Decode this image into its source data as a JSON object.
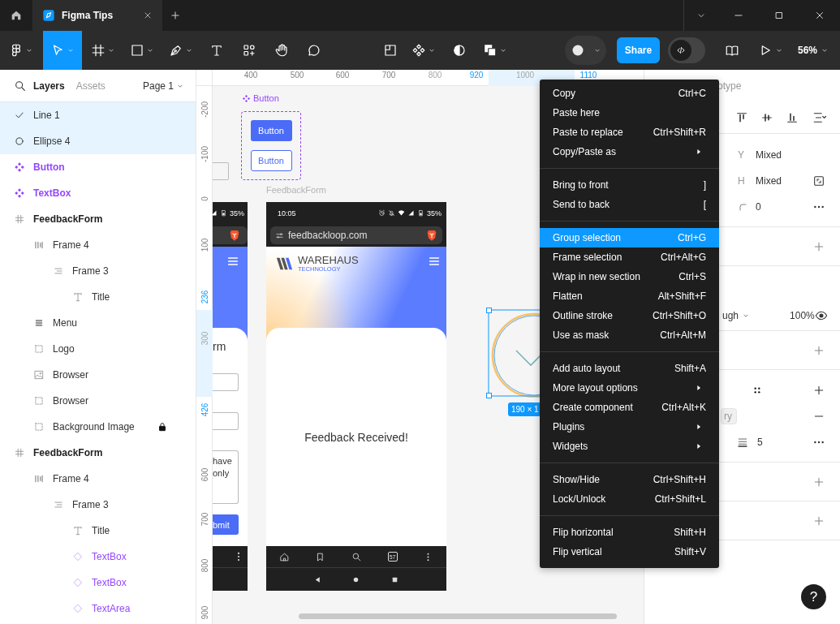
{
  "title_bar": {
    "tabs": [
      {
        "label": "Figma Tips",
        "selected": true
      }
    ]
  },
  "toolbar": {
    "tools": [
      {
        "kind": "main-menu",
        "selected": false,
        "menu": true
      },
      {
        "kind": "move",
        "selected": true,
        "menu": true
      },
      {
        "kind": "frame",
        "selected": false,
        "menu": true
      },
      {
        "kind": "rectangle",
        "selected": false,
        "menu": true
      },
      {
        "kind": "pen",
        "selected": false,
        "menu": true
      },
      {
        "kind": "text",
        "selected": false,
        "menu": false
      },
      {
        "kind": "resources",
        "selected": false,
        "menu": false
      },
      {
        "kind": "hand",
        "selected": false,
        "menu": false
      },
      {
        "kind": "comment",
        "selected": false,
        "menu": false
      }
    ],
    "actions": [
      {
        "kind": "layout",
        "menu": false
      },
      {
        "kind": "component",
        "menu": true
      },
      {
        "kind": "mask",
        "menu": false
      },
      {
        "kind": "boolean",
        "menu": true
      }
    ],
    "share": "Share",
    "dev_mode": {
      "on": false
    },
    "zoom": "56%"
  },
  "layers_panel": {
    "tabs": [
      {
        "label": "Layers",
        "selected": true
      },
      {
        "label": "Assets",
        "selected": false
      }
    ],
    "page": "Page 1",
    "layers": [
      {
        "name": "Line 1",
        "kind": "line",
        "selected": true,
        "locked": false
      },
      {
        "name": "Ellipse 4",
        "kind": "ellipse",
        "selected": true,
        "locked": false
      },
      {
        "name": "Button",
        "kind": "component-set",
        "selected": false,
        "locked": false
      },
      {
        "name": "TextBox",
        "kind": "component-set",
        "selected": false,
        "locked": false
      },
      {
        "name": "FeedbackForm",
        "kind": "frame",
        "selected": false,
        "locked": false,
        "children": [
          {
            "name": "Frame 4",
            "kind": "row",
            "selected": false,
            "locked": false,
            "children": [
              {
                "name": "Frame 3",
                "kind": "column",
                "selected": false,
                "locked": false,
                "children": [
                  {
                    "name": "Title",
                    "kind": "text",
                    "selected": false,
                    "locked": false
                  }
                ]
              }
            ]
          },
          {
            "name": "Menu",
            "kind": "stack",
            "selected": false,
            "locked": false
          },
          {
            "name": "Logo",
            "kind": "group",
            "selected": false,
            "locked": false
          },
          {
            "name": "Browser",
            "kind": "image",
            "selected": false,
            "locked": false
          },
          {
            "name": "Browser",
            "kind": "group",
            "selected": false,
            "locked": false
          },
          {
            "name": "Background Image",
            "kind": "group",
            "selected": false,
            "locked": true
          }
        ]
      },
      {
        "name": "FeedbackForm",
        "kind": "frame",
        "selected": false,
        "locked": false,
        "children": [
          {
            "name": "Frame 4",
            "kind": "row",
            "selected": false,
            "locked": false,
            "children": [
              {
                "name": "Frame 3",
                "kind": "column",
                "selected": false,
                "locked": false,
                "children": [
                  {
                    "name": "Title",
                    "kind": "text",
                    "selected": false,
                    "locked": false
                  },
                  {
                    "name": "TextBox",
                    "kind": "instance",
                    "selected": false,
                    "locked": false
                  },
                  {
                    "name": "TextBox",
                    "kind": "instance",
                    "selected": false,
                    "locked": false
                  },
                  {
                    "name": "TextArea",
                    "kind": "instance",
                    "selected": false,
                    "locked": false
                  }
                ]
              }
            ]
          }
        ]
      }
    ]
  },
  "canvas": {
    "ruler_top": [
      {
        "label": "400",
        "kind": "tick"
      },
      {
        "label": "500",
        "kind": "tick"
      },
      {
        "label": "600",
        "kind": "tick"
      },
      {
        "label": "700",
        "kind": "tick"
      },
      {
        "label": "800",
        "kind": "faded"
      },
      {
        "label": "920",
        "kind": "bound"
      },
      {
        "label": "1000",
        "kind": "faded"
      },
      {
        "label": "1110",
        "kind": "bound"
      }
    ],
    "ruler_left": [
      {
        "label": "-200",
        "kind": "tick"
      },
      {
        "label": "-100",
        "kind": "tick"
      },
      {
        "label": "0",
        "kind": "tick"
      },
      {
        "label": "100",
        "kind": "tick"
      },
      {
        "label": "236",
        "kind": "bound"
      },
      {
        "label": "300",
        "kind": "faded"
      },
      {
        "label": "426",
        "kind": "bound"
      },
      {
        "label": "600",
        "kind": "tick"
      },
      {
        "label": "700",
        "kind": "tick"
      },
      {
        "label": "800",
        "kind": "tick"
      },
      {
        "label": "900",
        "kind": "tick"
      }
    ],
    "component_set": {
      "label": "Button",
      "buttons": [
        {
          "label": "Button",
          "kind": "filled"
        },
        {
          "label": "Button",
          "kind": "outline"
        }
      ]
    },
    "frame_label": "FeedbackForm",
    "phone_left": {
      "battery": "35%",
      "title": "rm",
      "lines": [
        "have",
        "only"
      ],
      "submit": "bmit"
    },
    "phone": {
      "time": "10:05",
      "battery": "35%",
      "url": "feedbackloop.com",
      "brand": "WAREHAUS",
      "brand_sub": "TECHNOLOGY",
      "message": "Feedback Received!",
      "tab_count": "57"
    },
    "selection": {
      "size": "190 × 1"
    }
  },
  "context_menu": {
    "groups": [
      [
        {
          "label": "Copy",
          "shortcut": "Ctrl+C",
          "submenu": false,
          "selected": false
        },
        {
          "label": "Paste here",
          "submenu": false,
          "selected": false
        },
        {
          "label": "Paste to replace",
          "shortcut": "Ctrl+Shift+R",
          "submenu": false,
          "selected": false
        },
        {
          "label": "Copy/Paste as",
          "submenu": true,
          "selected": false
        }
      ],
      [
        {
          "label": "Bring to front",
          "shortcut": "]",
          "submenu": false,
          "selected": false
        },
        {
          "label": "Send to back",
          "shortcut": "[",
          "submenu": false,
          "selected": false
        }
      ],
      [
        {
          "label": "Group selection",
          "shortcut": "Ctrl+G",
          "submenu": false,
          "selected": true
        },
        {
          "label": "Frame selection",
          "shortcut": "Ctrl+Alt+G",
          "submenu": false,
          "selected": false
        },
        {
          "label": "Wrap in new section",
          "shortcut": "Ctrl+S",
          "submenu": false,
          "selected": false
        },
        {
          "label": "Flatten",
          "shortcut": "Alt+Shift+F",
          "submenu": false,
          "selected": false
        },
        {
          "label": "Outline stroke",
          "shortcut": "Ctrl+Shift+O",
          "submenu": false,
          "selected": false
        },
        {
          "label": "Use as mask",
          "shortcut": "Ctrl+Alt+M",
          "submenu": false,
          "selected": false
        }
      ],
      [
        {
          "label": "Add auto layout",
          "shortcut": "Shift+A",
          "submenu": false,
          "selected": false
        },
        {
          "label": "More layout options",
          "submenu": true,
          "selected": false
        },
        {
          "label": "Create component",
          "shortcut": "Ctrl+Alt+K",
          "submenu": false,
          "selected": false
        },
        {
          "label": "Plugins",
          "submenu": true,
          "selected": false
        },
        {
          "label": "Widgets",
          "submenu": true,
          "selected": false
        }
      ],
      [
        {
          "label": "Show/Hide",
          "shortcut": "Ctrl+Shift+H",
          "submenu": false,
          "selected": false
        },
        {
          "label": "Lock/Unlock",
          "shortcut": "Ctrl+Shift+L",
          "submenu": false,
          "selected": false
        }
      ],
      [
        {
          "label": "Flip horizontal",
          "shortcut": "Shift+H",
          "submenu": false,
          "selected": false
        },
        {
          "label": "Flip vertical",
          "shortcut": "Shift+V",
          "submenu": false,
          "selected": false
        }
      ]
    ]
  },
  "design_panel": {
    "tab": "otype",
    "fields": [
      {
        "label": "Y",
        "value": "Mixed"
      },
      {
        "label": "H",
        "value": "Mixed"
      }
    ],
    "radius": "0",
    "blend": "ugh",
    "opacity": "100%",
    "visible": true,
    "chip": "ry",
    "count": "5",
    "help": "?"
  }
}
